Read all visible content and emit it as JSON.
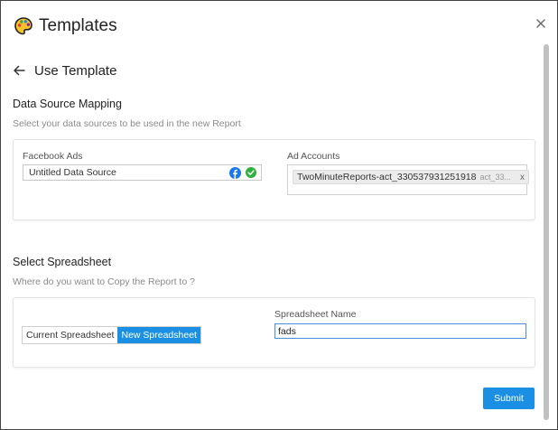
{
  "header": {
    "title": "Templates",
    "icon": "palette-icon"
  },
  "subheader": {
    "title": "Use Template",
    "icon": "back-arrow-icon"
  },
  "data_source_section": {
    "title": "Data Source Mapping",
    "subtitle": "Select your data sources to be used in the new Report",
    "facebook_label": "Facebook Ads",
    "data_source_value": "Untitled Data Source",
    "ad_accounts_label": "Ad Accounts",
    "ad_account_chip": {
      "name": "TwoMinuteReports-act_330537931251918",
      "id_preview": "act_33...",
      "remove": "x"
    }
  },
  "spreadsheet_section": {
    "title": "Select Spreadsheet",
    "subtitle": "Where do you want to Copy the Report to ?",
    "toggle": {
      "current": "Current Spreadsheet",
      "new": "New Spreadsheet",
      "selected": "new"
    },
    "name_label": "Spreadsheet Name",
    "name_value": "fads"
  },
  "footer": {
    "submit_label": "Submit"
  },
  "colors": {
    "accent": "#1a8fe3",
    "facebook": "#1877f2",
    "success": "#2eaf3e"
  }
}
